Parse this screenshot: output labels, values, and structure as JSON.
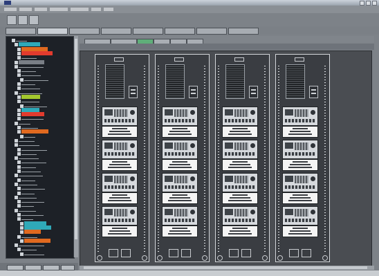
{
  "window": {
    "title": ""
  },
  "menubar": {
    "items": [
      "",
      "",
      "",
      "",
      "",
      "",
      ""
    ]
  },
  "toolbar": {
    "buttons": [
      "",
      "",
      ""
    ]
  },
  "tabs": {
    "items": [
      "",
      "",
      "",
      "",
      "",
      "",
      "",
      ""
    ],
    "active_index": 1
  },
  "tree": {
    "rows": [
      {
        "label": "",
        "highlight": ""
      },
      {
        "label": "",
        "highlight": "#2fa9b8"
      },
      {
        "label": "",
        "highlight": "#e0691f"
      },
      {
        "label": "",
        "highlight": "#e23b2e"
      },
      {
        "label": "",
        "highlight": ""
      },
      {
        "label": "",
        "highlight": "#7a7f86"
      },
      {
        "label": "",
        "highlight": ""
      },
      {
        "label": "",
        "highlight": ""
      },
      {
        "label": "",
        "highlight": ""
      },
      {
        "label": "",
        "highlight": ""
      },
      {
        "label": "",
        "highlight": ""
      },
      {
        "label": "",
        "highlight": ""
      },
      {
        "label": "",
        "highlight": ""
      },
      {
        "label": "",
        "highlight": "#a3c82e"
      },
      {
        "label": "",
        "highlight": ""
      },
      {
        "label": "",
        "highlight": ""
      },
      {
        "label": "",
        "highlight": "#2fa9b8"
      },
      {
        "label": "",
        "highlight": "#e23b2e"
      },
      {
        "label": "",
        "highlight": ""
      },
      {
        "label": "",
        "highlight": ""
      },
      {
        "label": "",
        "highlight": ""
      },
      {
        "label": "",
        "highlight": "#e0691f"
      },
      {
        "label": "",
        "highlight": ""
      },
      {
        "label": "",
        "highlight": ""
      },
      {
        "label": "",
        "highlight": ""
      },
      {
        "label": "",
        "highlight": ""
      },
      {
        "label": "",
        "highlight": ""
      },
      {
        "label": "",
        "highlight": ""
      },
      {
        "label": "",
        "highlight": ""
      },
      {
        "label": "",
        "highlight": ""
      },
      {
        "label": "",
        "highlight": ""
      },
      {
        "label": "",
        "highlight": ""
      },
      {
        "label": "",
        "highlight": ""
      },
      {
        "label": "",
        "highlight": ""
      },
      {
        "label": "",
        "highlight": ""
      },
      {
        "label": "",
        "highlight": ""
      },
      {
        "label": "",
        "highlight": ""
      },
      {
        "label": "",
        "highlight": ""
      },
      {
        "label": "",
        "highlight": ""
      },
      {
        "label": "",
        "highlight": ""
      },
      {
        "label": "",
        "highlight": ""
      },
      {
        "label": "",
        "highlight": ""
      },
      {
        "label": "",
        "highlight": "#2fa9b8"
      },
      {
        "label": "",
        "highlight": "#2fa9b8"
      },
      {
        "label": "",
        "highlight": "#e0691f"
      },
      {
        "label": "",
        "highlight": ""
      },
      {
        "label": "",
        "highlight": "#e0691f"
      },
      {
        "label": "",
        "highlight": ""
      },
      {
        "label": "",
        "highlight": ""
      },
      {
        "label": "",
        "highlight": ""
      }
    ]
  },
  "panel": {
    "tabs": [
      "",
      "",
      "",
      "",
      "",
      ""
    ],
    "active_index": 2
  },
  "racks": [
    {
      "name": "",
      "units": [
        "",
        "",
        "",
        ""
      ]
    },
    {
      "name": "",
      "units": [
        "",
        "",
        "",
        ""
      ]
    },
    {
      "name": "",
      "units": [
        "",
        "",
        "",
        ""
      ]
    },
    {
      "name": "",
      "units": [
        "",
        "",
        "",
        ""
      ]
    }
  ],
  "status": {
    "items": [
      "",
      "",
      "",
      ""
    ]
  },
  "colors": {
    "canvas": "#4a4d52",
    "tree_bg": "#1d2127",
    "accent_green": "#5fae79"
  }
}
